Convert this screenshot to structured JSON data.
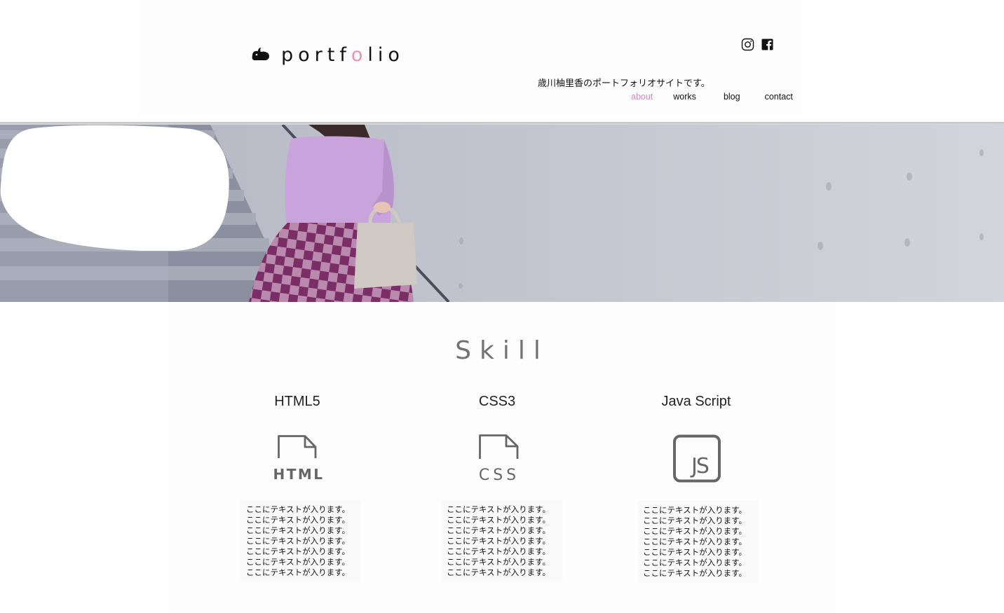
{
  "header": {
    "logo_text_before": "portf",
    "logo_text_accent": "o",
    "logo_text_after": "lio",
    "social": [
      {
        "icon": "instagram-icon"
      },
      {
        "icon": "facebook-icon"
      }
    ],
    "nav": [
      {
        "label": "about",
        "active": true
      },
      {
        "label": "works",
        "active": false
      },
      {
        "label": "blog",
        "active": false
      },
      {
        "label": "contact",
        "active": false
      }
    ]
  },
  "hero": {
    "bubble_text": "歳川柚里香のポートフォリオサイトです。"
  },
  "skills": {
    "title": "Skill",
    "items": [
      {
        "name": "HTML5",
        "icon": "html-file-icon",
        "icon_label": "HTML",
        "lines": [
          "ここにテキストが入ります。",
          "ここにテキストが入ります。",
          "ここにテキストが入ります。",
          "ここにテキストが入ります。",
          "ここにテキストが入ります。",
          "ここにテキストが入ります。",
          "ここにテキストが入ります。"
        ]
      },
      {
        "name": "CSS3",
        "icon": "css-file-icon",
        "icon_label": "CSS",
        "lines": [
          "ここにテキストが入ります。",
          "ここにテキストが入ります。",
          "ここにテキストが入ります。",
          "ここにテキストが入ります。",
          "ここにテキストが入ります。",
          "ここにテキストが入ります。",
          "ここにテキストが入ります。"
        ]
      },
      {
        "name": "Java Script",
        "icon": "javascript-icon",
        "icon_label": "JS",
        "lines": [
          "ここにテキストが入ります。",
          "ここにテキストが入ります。",
          "ここにテキストが入ります。",
          "ここにテキストが入ります。",
          "ここにテキストが入ります。",
          "ここにテキストが入ります。",
          "ここにテキストが入ります。"
        ]
      }
    ]
  },
  "colors": {
    "accent": "#ee8fb8",
    "nav_active": "#d685c0",
    "icon_gray": "#666666"
  }
}
